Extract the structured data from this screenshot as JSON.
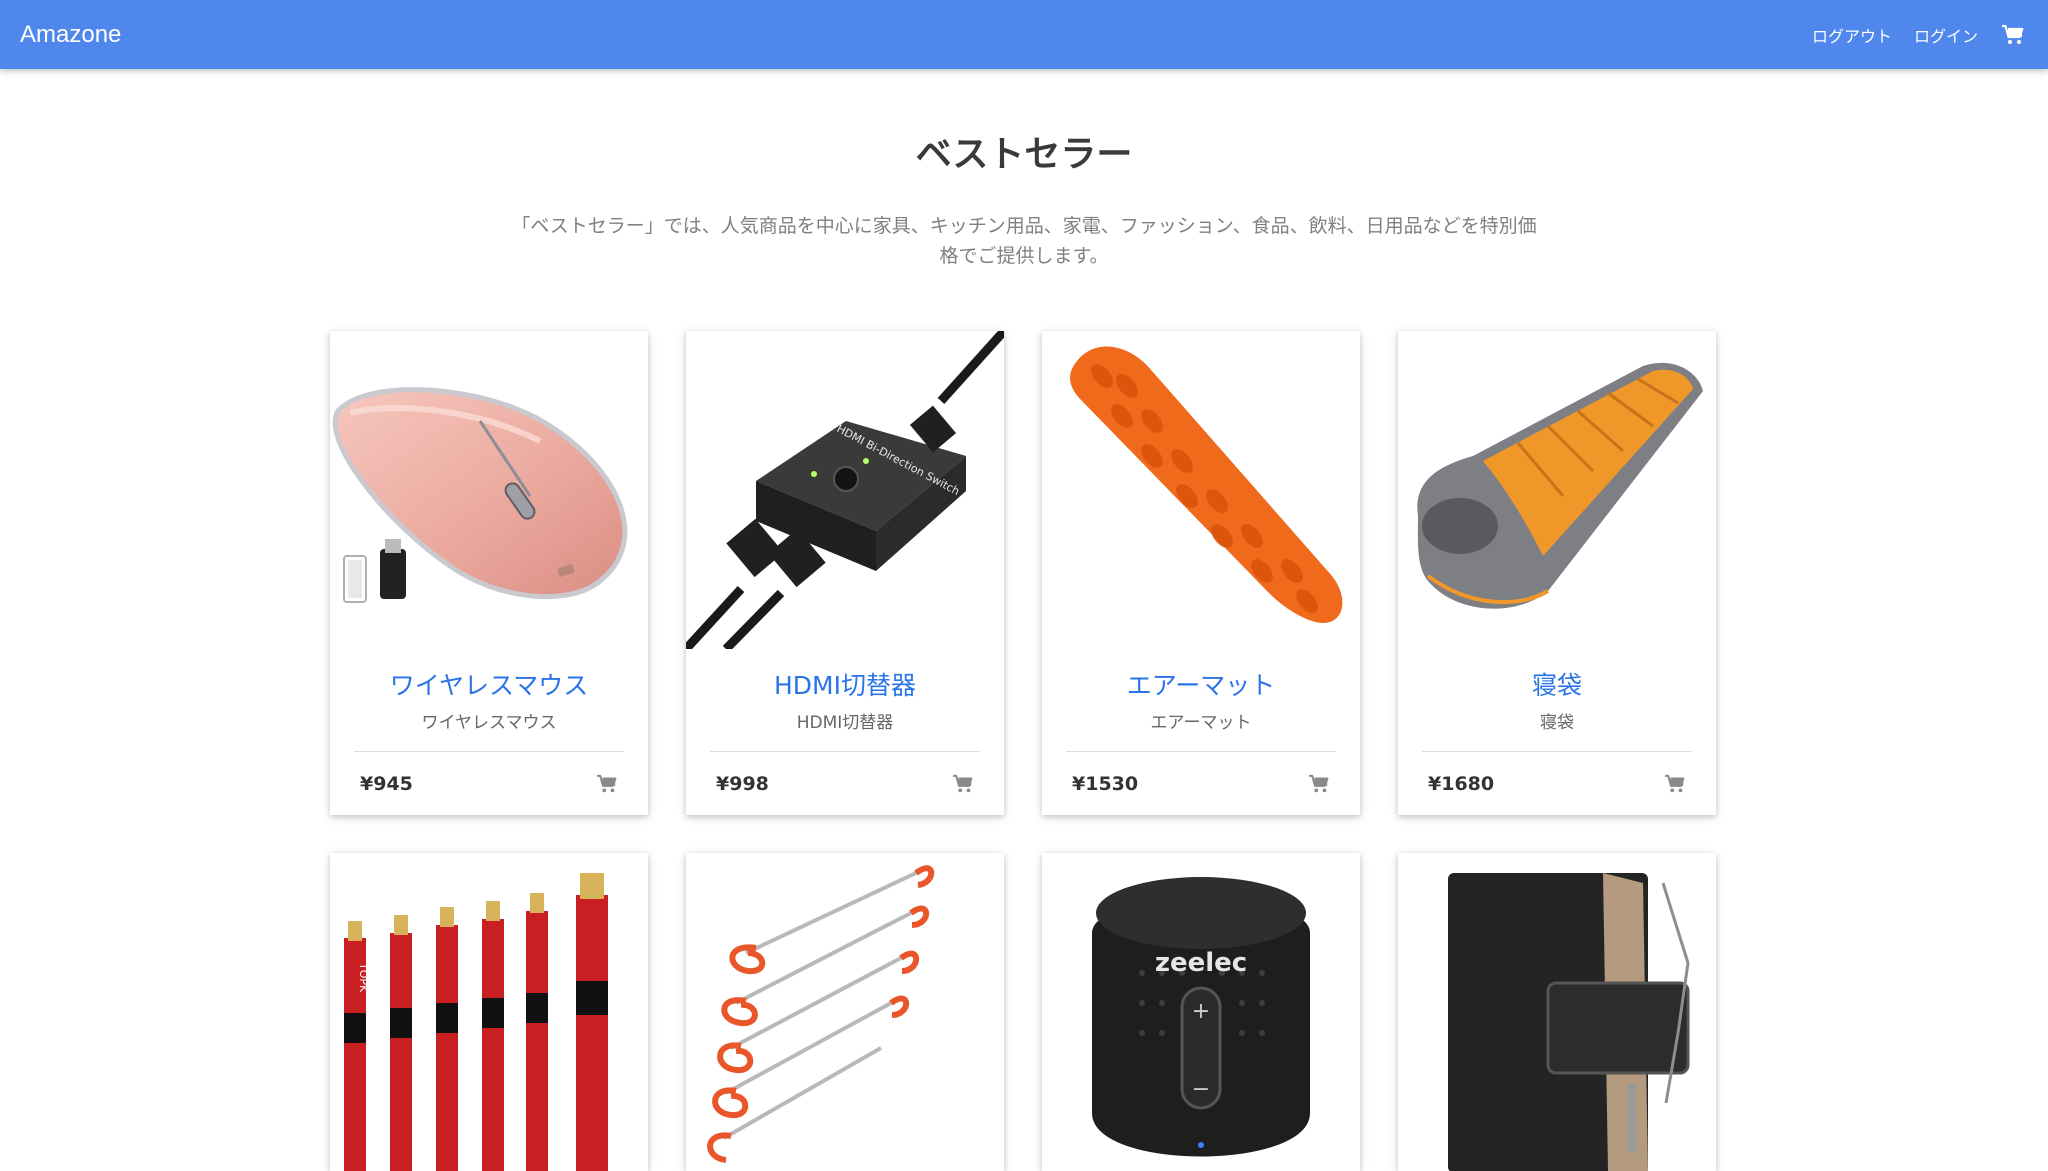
{
  "header": {
    "brand": "Amazone",
    "logout_label": "ログアウト",
    "login_label": "ログイン",
    "cart_icon": "cart-icon"
  },
  "main": {
    "title": "ベストセラー",
    "description": "「ベストセラー」では、人気商品を中心に家具、キッチン用品、家電、ファッション、食品、飲料、日用品などを特別価格でご提供します。"
  },
  "products": [
    {
      "title": "ワイヤレスマウス",
      "subtitle": "ワイヤレスマウス",
      "price": "¥945"
    },
    {
      "title": "HDMI切替器",
      "subtitle": "HDMI切替器",
      "price": "¥998"
    },
    {
      "title": "エアーマット",
      "subtitle": "エアーマット",
      "price": "¥1530"
    },
    {
      "title": "寝袋",
      "subtitle": "寝袋",
      "price": "¥1680"
    },
    {
      "title": "",
      "subtitle": "",
      "price": ""
    },
    {
      "title": "",
      "subtitle": "",
      "price": ""
    },
    {
      "title": "",
      "subtitle": "",
      "price": ""
    },
    {
      "title": "",
      "subtitle": "",
      "price": ""
    }
  ],
  "images": {
    "speaker_brand": "zeelec",
    "cable_brand": "TOPK",
    "hdmi_label": "HDMI Bi-Direction Switch"
  },
  "colors": {
    "navbar": "#4f87ec",
    "product_title": "#2a74e8"
  }
}
